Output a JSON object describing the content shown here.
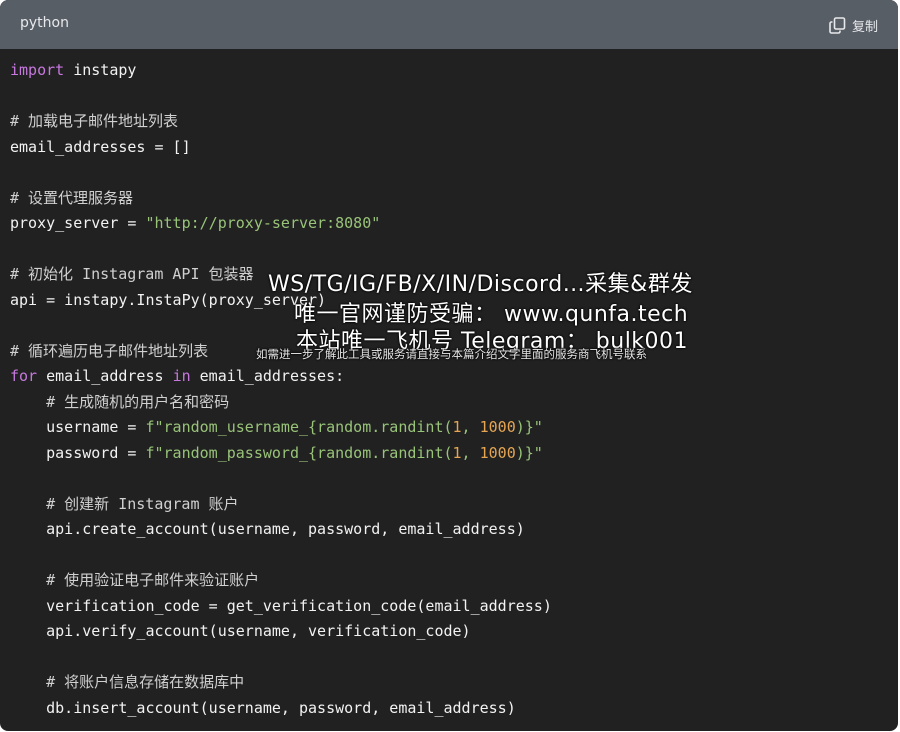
{
  "header": {
    "language": "python",
    "copy_label": "复制"
  },
  "code_lines": [
    [
      [
        "import",
        "kw"
      ],
      [
        " instapy",
        ""
      ]
    ],
    [],
    [
      [
        "# 加载电子邮件地址列表",
        "cm"
      ]
    ],
    [
      [
        "email_addresses = []",
        ""
      ]
    ],
    [],
    [
      [
        "# 设置代理服务器",
        "cm"
      ]
    ],
    [
      [
        "proxy_server = ",
        ""
      ],
      [
        "\"http://proxy-server:8080\"",
        "str"
      ]
    ],
    [],
    [
      [
        "# 初始化 Instagram API 包装器",
        "cm"
      ]
    ],
    [
      [
        "api = instapy.InstaPy(proxy_server)",
        ""
      ]
    ],
    [],
    [
      [
        "# 循环遍历电子邮件地址列表",
        "cm"
      ]
    ],
    [
      [
        "for",
        "kw"
      ],
      [
        " email_address ",
        ""
      ],
      [
        "in",
        "kw"
      ],
      [
        " email_addresses:",
        ""
      ]
    ],
    [
      [
        "    # 生成随机的用户名和密码",
        "cm"
      ]
    ],
    [
      [
        "    username = ",
        ""
      ],
      [
        "f\"random_username_{random.randint(",
        "str"
      ],
      [
        "1",
        "num"
      ],
      [
        ", ",
        "str"
      ],
      [
        "1000",
        "num"
      ],
      [
        ")}\"",
        "str"
      ]
    ],
    [
      [
        "    password = ",
        ""
      ],
      [
        "f\"random_password_{random.randint(",
        "str"
      ],
      [
        "1",
        "num"
      ],
      [
        ", ",
        "str"
      ],
      [
        "1000",
        "num"
      ],
      [
        ")}\"",
        "str"
      ]
    ],
    [],
    [
      [
        "    # 创建新 Instagram 账户",
        "cm"
      ]
    ],
    [
      [
        "    api.create_account(username, password, email_address)",
        ""
      ]
    ],
    [],
    [
      [
        "    # 使用验证电子邮件来验证账户",
        "cm"
      ]
    ],
    [
      [
        "    verification_code = get_verification_code(email_address)",
        ""
      ]
    ],
    [
      [
        "    api.verify_account(username, verification_code)",
        ""
      ]
    ],
    [],
    [
      [
        "    # 将账户信息存储在数据库中",
        "cm"
      ]
    ],
    [
      [
        "    db.insert_account(username, password, email_address)",
        ""
      ]
    ]
  ],
  "watermark": {
    "line1": "WS/TG/IG/FB/X/IN/Discord…采集&群发",
    "line2": "唯一官网谨防受骗： www.qunfa.tech",
    "line3": "本站唯一飞机号 Telegram： bulk001",
    "line4": "如需进一步了解此工具或服务请直接与本篇介绍文字里面的服务商飞机号联系"
  }
}
